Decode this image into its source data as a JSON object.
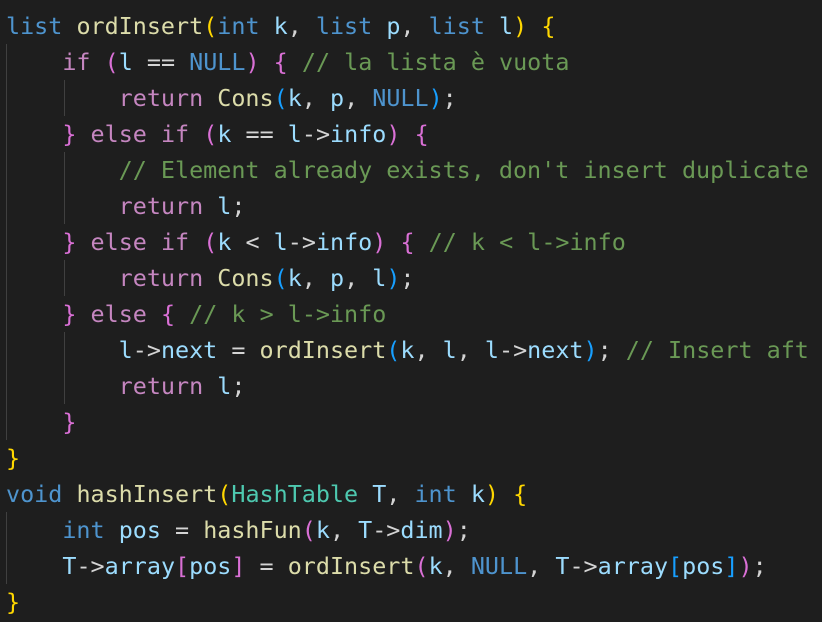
{
  "colors": {
    "background": "#1e1e1e",
    "keyword": "#4e94ce",
    "control": "#c586c0",
    "function": "#dcdcaa",
    "variable": "#9cdcfe",
    "type": "#4ec9b0",
    "comment": "#6a9955",
    "bracket_level_1": "#ffd700",
    "bracket_level_2": "#da70d6",
    "bracket_level_3": "#179fff",
    "plain": "#d4d4d4"
  },
  "code_lines": [
    [
      {
        "t": "list",
        "c": "kw"
      },
      {
        "t": " ",
        "c": "op"
      },
      {
        "t": "ordInsert",
        "c": "fn"
      },
      {
        "t": "(",
        "c": "p1"
      },
      {
        "t": "int",
        "c": "kw"
      },
      {
        "t": " ",
        "c": "op"
      },
      {
        "t": "k",
        "c": "var"
      },
      {
        "t": ", ",
        "c": "op"
      },
      {
        "t": "list",
        "c": "kw"
      },
      {
        "t": " ",
        "c": "op"
      },
      {
        "t": "p",
        "c": "var"
      },
      {
        "t": ", ",
        "c": "op"
      },
      {
        "t": "list",
        "c": "kw"
      },
      {
        "t": " ",
        "c": "op"
      },
      {
        "t": "l",
        "c": "var"
      },
      {
        "t": ")",
        "c": "p1"
      },
      {
        "t": " ",
        "c": "op"
      },
      {
        "t": "{",
        "c": "p1"
      }
    ],
    [
      {
        "t": "    ",
        "c": "op"
      },
      {
        "t": "if",
        "c": "ctl"
      },
      {
        "t": " ",
        "c": "op"
      },
      {
        "t": "(",
        "c": "p2"
      },
      {
        "t": "l",
        "c": "var"
      },
      {
        "t": " == ",
        "c": "op"
      },
      {
        "t": "NULL",
        "c": "kw"
      },
      {
        "t": ")",
        "c": "p2"
      },
      {
        "t": " ",
        "c": "op"
      },
      {
        "t": "{",
        "c": "p2"
      },
      {
        "t": " ",
        "c": "op"
      },
      {
        "t": "// la lista è vuota",
        "c": "cmt"
      }
    ],
    [
      {
        "t": "        ",
        "c": "op"
      },
      {
        "t": "return",
        "c": "ctl"
      },
      {
        "t": " ",
        "c": "op"
      },
      {
        "t": "Cons",
        "c": "fn"
      },
      {
        "t": "(",
        "c": "p3"
      },
      {
        "t": "k",
        "c": "var"
      },
      {
        "t": ", ",
        "c": "op"
      },
      {
        "t": "p",
        "c": "var"
      },
      {
        "t": ", ",
        "c": "op"
      },
      {
        "t": "NULL",
        "c": "kw"
      },
      {
        "t": ")",
        "c": "p3"
      },
      {
        "t": ";",
        "c": "op"
      }
    ],
    [
      {
        "t": "    ",
        "c": "op"
      },
      {
        "t": "}",
        "c": "p2"
      },
      {
        "t": " ",
        "c": "op"
      },
      {
        "t": "else",
        "c": "ctl"
      },
      {
        "t": " ",
        "c": "op"
      },
      {
        "t": "if",
        "c": "ctl"
      },
      {
        "t": " ",
        "c": "op"
      },
      {
        "t": "(",
        "c": "p2"
      },
      {
        "t": "k",
        "c": "var"
      },
      {
        "t": " == ",
        "c": "op"
      },
      {
        "t": "l",
        "c": "var"
      },
      {
        "t": "->",
        "c": "op"
      },
      {
        "t": "info",
        "c": "var"
      },
      {
        "t": ")",
        "c": "p2"
      },
      {
        "t": " ",
        "c": "op"
      },
      {
        "t": "{",
        "c": "p2"
      }
    ],
    [
      {
        "t": "        ",
        "c": "op"
      },
      {
        "t": "// Element already exists, don't insert duplicate",
        "c": "cmt"
      }
    ],
    [
      {
        "t": "        ",
        "c": "op"
      },
      {
        "t": "return",
        "c": "ctl"
      },
      {
        "t": " ",
        "c": "op"
      },
      {
        "t": "l",
        "c": "var"
      },
      {
        "t": ";",
        "c": "op"
      }
    ],
    [
      {
        "t": "    ",
        "c": "op"
      },
      {
        "t": "}",
        "c": "p2"
      },
      {
        "t": " ",
        "c": "op"
      },
      {
        "t": "else",
        "c": "ctl"
      },
      {
        "t": " ",
        "c": "op"
      },
      {
        "t": "if",
        "c": "ctl"
      },
      {
        "t": " ",
        "c": "op"
      },
      {
        "t": "(",
        "c": "p2"
      },
      {
        "t": "k",
        "c": "var"
      },
      {
        "t": " < ",
        "c": "op"
      },
      {
        "t": "l",
        "c": "var"
      },
      {
        "t": "->",
        "c": "op"
      },
      {
        "t": "info",
        "c": "var"
      },
      {
        "t": ")",
        "c": "p2"
      },
      {
        "t": " ",
        "c": "op"
      },
      {
        "t": "{",
        "c": "p2"
      },
      {
        "t": " ",
        "c": "op"
      },
      {
        "t": "// k < l->info",
        "c": "cmt"
      }
    ],
    [
      {
        "t": "        ",
        "c": "op"
      },
      {
        "t": "return",
        "c": "ctl"
      },
      {
        "t": " ",
        "c": "op"
      },
      {
        "t": "Cons",
        "c": "fn"
      },
      {
        "t": "(",
        "c": "p3"
      },
      {
        "t": "k",
        "c": "var"
      },
      {
        "t": ", ",
        "c": "op"
      },
      {
        "t": "p",
        "c": "var"
      },
      {
        "t": ", ",
        "c": "op"
      },
      {
        "t": "l",
        "c": "var"
      },
      {
        "t": ")",
        "c": "p3"
      },
      {
        "t": ";",
        "c": "op"
      }
    ],
    [
      {
        "t": "    ",
        "c": "op"
      },
      {
        "t": "}",
        "c": "p2"
      },
      {
        "t": " ",
        "c": "op"
      },
      {
        "t": "else",
        "c": "ctl"
      },
      {
        "t": " ",
        "c": "op"
      },
      {
        "t": "{",
        "c": "p2"
      },
      {
        "t": " ",
        "c": "op"
      },
      {
        "t": "// k > l->info",
        "c": "cmt"
      }
    ],
    [
      {
        "t": "        ",
        "c": "op"
      },
      {
        "t": "l",
        "c": "var"
      },
      {
        "t": "->",
        "c": "op"
      },
      {
        "t": "next",
        "c": "var"
      },
      {
        "t": " = ",
        "c": "op"
      },
      {
        "t": "ordInsert",
        "c": "fn"
      },
      {
        "t": "(",
        "c": "p3"
      },
      {
        "t": "k",
        "c": "var"
      },
      {
        "t": ", ",
        "c": "op"
      },
      {
        "t": "l",
        "c": "var"
      },
      {
        "t": ", ",
        "c": "op"
      },
      {
        "t": "l",
        "c": "var"
      },
      {
        "t": "->",
        "c": "op"
      },
      {
        "t": "next",
        "c": "var"
      },
      {
        "t": ")",
        "c": "p3"
      },
      {
        "t": ";",
        "c": "op"
      },
      {
        "t": " ",
        "c": "op"
      },
      {
        "t": "// Insert aft",
        "c": "cmt"
      }
    ],
    [
      {
        "t": "        ",
        "c": "op"
      },
      {
        "t": "return",
        "c": "ctl"
      },
      {
        "t": " ",
        "c": "op"
      },
      {
        "t": "l",
        "c": "var"
      },
      {
        "t": ";",
        "c": "op"
      }
    ],
    [
      {
        "t": "    ",
        "c": "op"
      },
      {
        "t": "}",
        "c": "p2"
      }
    ],
    [
      {
        "t": "}",
        "c": "p1"
      }
    ],
    [
      {
        "t": "void",
        "c": "kw"
      },
      {
        "t": " ",
        "c": "op"
      },
      {
        "t": "hashInsert",
        "c": "fn"
      },
      {
        "t": "(",
        "c": "p1"
      },
      {
        "t": "HashTable",
        "c": "type"
      },
      {
        "t": " ",
        "c": "op"
      },
      {
        "t": "T",
        "c": "var"
      },
      {
        "t": ", ",
        "c": "op"
      },
      {
        "t": "int",
        "c": "kw"
      },
      {
        "t": " ",
        "c": "op"
      },
      {
        "t": "k",
        "c": "var"
      },
      {
        "t": ")",
        "c": "p1"
      },
      {
        "t": " ",
        "c": "op"
      },
      {
        "t": "{",
        "c": "p1"
      }
    ],
    [
      {
        "t": "    ",
        "c": "op"
      },
      {
        "t": "int",
        "c": "kw"
      },
      {
        "t": " ",
        "c": "op"
      },
      {
        "t": "pos",
        "c": "var"
      },
      {
        "t": " = ",
        "c": "op"
      },
      {
        "t": "hashFun",
        "c": "fn"
      },
      {
        "t": "(",
        "c": "p2"
      },
      {
        "t": "k",
        "c": "var"
      },
      {
        "t": ", ",
        "c": "op"
      },
      {
        "t": "T",
        "c": "var"
      },
      {
        "t": "->",
        "c": "op"
      },
      {
        "t": "dim",
        "c": "var"
      },
      {
        "t": ")",
        "c": "p2"
      },
      {
        "t": ";",
        "c": "op"
      }
    ],
    [
      {
        "t": "    ",
        "c": "op"
      },
      {
        "t": "T",
        "c": "var"
      },
      {
        "t": "->",
        "c": "op"
      },
      {
        "t": "array",
        "c": "var"
      },
      {
        "t": "[",
        "c": "p2"
      },
      {
        "t": "pos",
        "c": "var"
      },
      {
        "t": "]",
        "c": "p2"
      },
      {
        "t": " = ",
        "c": "op"
      },
      {
        "t": "ordInsert",
        "c": "fn"
      },
      {
        "t": "(",
        "c": "p2"
      },
      {
        "t": "k",
        "c": "var"
      },
      {
        "t": ", ",
        "c": "op"
      },
      {
        "t": "NULL",
        "c": "kw"
      },
      {
        "t": ", ",
        "c": "op"
      },
      {
        "t": "T",
        "c": "var"
      },
      {
        "t": "->",
        "c": "op"
      },
      {
        "t": "array",
        "c": "var"
      },
      {
        "t": "[",
        "c": "p3"
      },
      {
        "t": "pos",
        "c": "var"
      },
      {
        "t": "]",
        "c": "p3"
      },
      {
        "t": ")",
        "c": "p2"
      },
      {
        "t": ";",
        "c": "op"
      }
    ],
    [
      {
        "t": "}",
        "c": "p1"
      }
    ]
  ]
}
